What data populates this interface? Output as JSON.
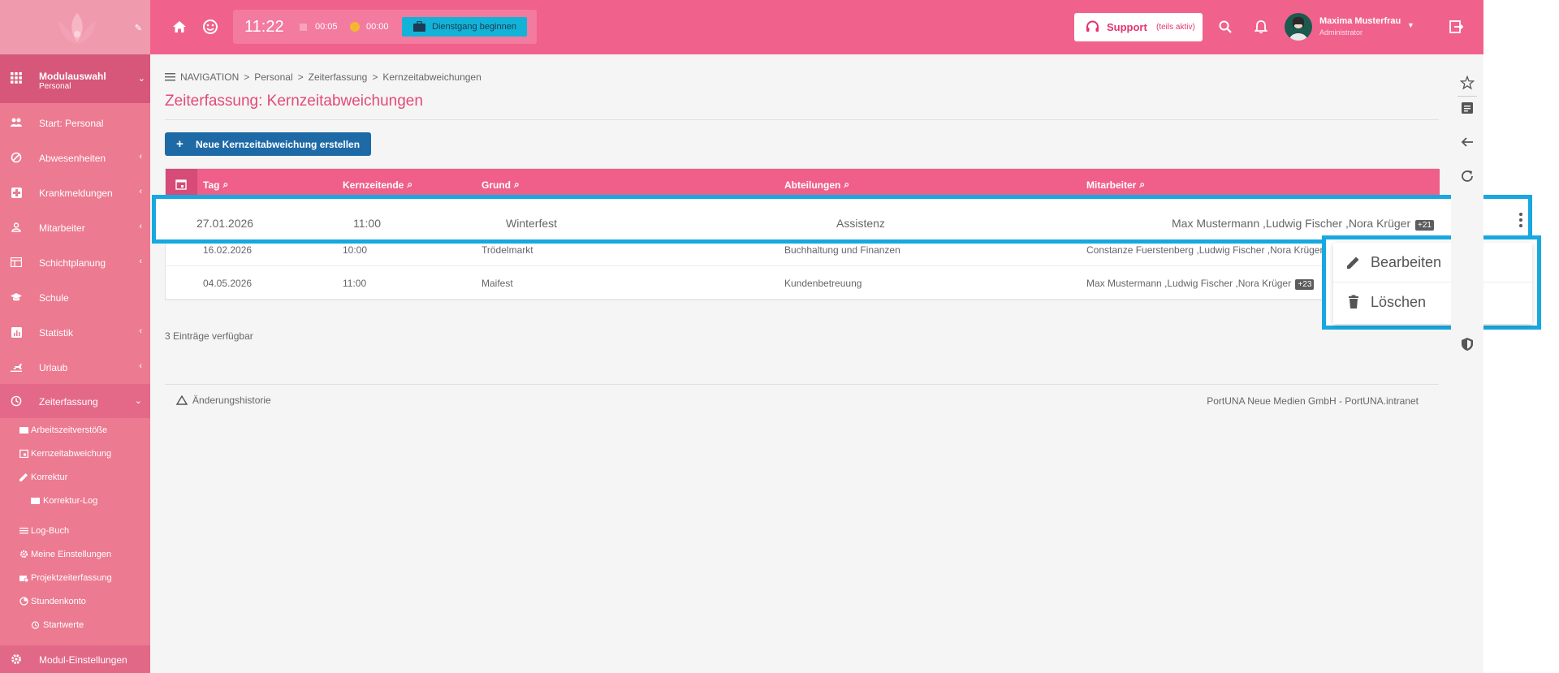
{
  "sidebar": {
    "module": {
      "title": "Modulauswahl",
      "subtitle": "Personal"
    },
    "items": [
      {
        "label": "Start: Personal"
      },
      {
        "label": "Abwesenheiten"
      },
      {
        "label": "Krankmeldungen"
      },
      {
        "label": "Mitarbeiter"
      },
      {
        "label": "Schichtplanung"
      },
      {
        "label": "Schule"
      },
      {
        "label": "Statistik"
      },
      {
        "label": "Urlaub"
      },
      {
        "label": "Zeiterfassung"
      }
    ],
    "subitems": [
      {
        "label": "Arbeitszeitverstöße"
      },
      {
        "label": "Kernzeitabweichung"
      },
      {
        "label": "Korrektur"
      },
      {
        "label": "Korrektur-Log"
      },
      {
        "label": "Log-Buch"
      },
      {
        "label": "Meine Einstellungen"
      },
      {
        "label": "Projektzeiterfassung"
      },
      {
        "label": "Stundenkonto"
      },
      {
        "label": "Startwerte"
      }
    ],
    "bottom_label": "Modul-Einstellungen"
  },
  "topbar": {
    "time": "11:22",
    "counter1": "00:05",
    "counter2": "00:00",
    "dienst_label": "Dienstgang beginnen",
    "support_label": "Support",
    "support_sub": "(teils aktiv)",
    "user_name": "Maxima Musterfrau",
    "user_role": "Administrator"
  },
  "breadcrumb": [
    "NAVIGATION",
    "Personal",
    "Zeiterfassung",
    "Kernzeitabweichungen"
  ],
  "page_title": "Zeiterfassung: Kernzeitabweichungen",
  "new_button": "Neue Kernzeitabweichung erstellen",
  "table": {
    "columns": [
      "Tag",
      "Kernzeitende",
      "Grund",
      "Abteilungen",
      "Mitarbeiter"
    ],
    "rows": [
      {
        "tag": "27.01.2026",
        "ende": "11:00",
        "grund": "Winterfest",
        "abt": "Assistenz",
        "mit": "Max Mustermann ,Ludwig Fischer ,Nora Krüger",
        "badge": "+21"
      },
      {
        "tag": "16.02.2026",
        "ende": "10:00",
        "grund": "Trödelmarkt",
        "abt": "Buchhaltung und Finanzen",
        "mit": "Constanze Fuerstenberg ,Ludwig Fischer ,Nora Krüger",
        "badge": ""
      },
      {
        "tag": "04.05.2026",
        "ende": "11:00",
        "grund": "Maifest",
        "abt": "Kundenbetreuung",
        "mit": "Max Mustermann ,Ludwig Fischer ,Nora Krüger",
        "badge": "+23"
      }
    ]
  },
  "entries_text": "3 Einträge verfügbar",
  "history_label": "Änderungshistorie",
  "copyright": "PortUNA Neue Medien GmbH - PortUNA.intranet",
  "context_menu": {
    "edit": "Bearbeiten",
    "delete": "Löschen"
  },
  "colors": {
    "brand_pink": "#f0628c",
    "sidebar": "#ec7a91",
    "highlight": "#18a8e0",
    "primary_button": "#1e6aa6"
  }
}
